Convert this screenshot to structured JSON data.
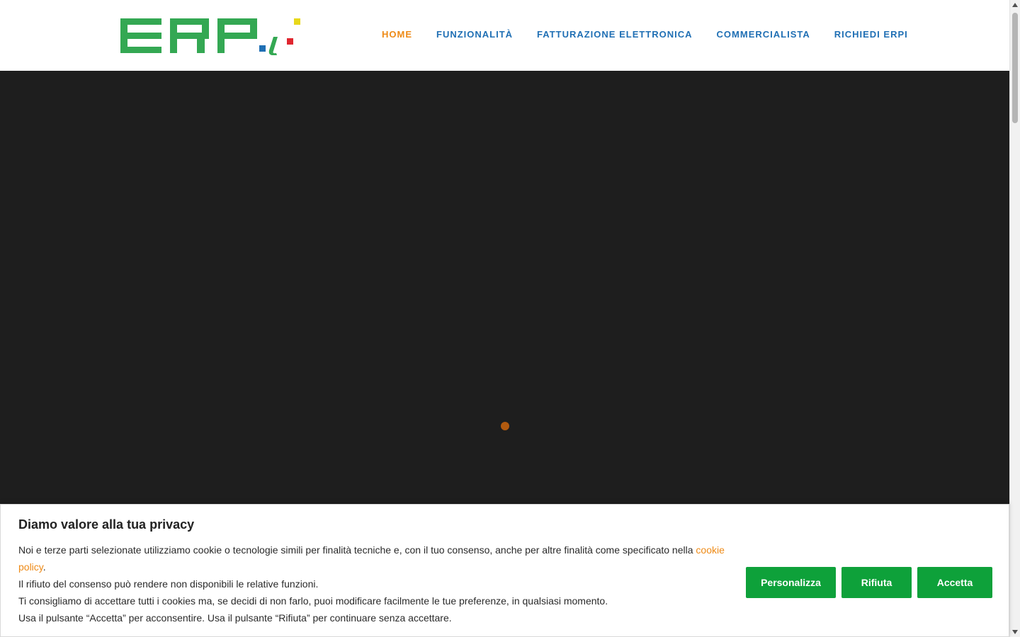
{
  "brand": {
    "logo_text": "ERPi",
    "colors": {
      "green": "#34a853",
      "blue": "#1f6fb4",
      "red": "#e0262f",
      "yellow": "#e8d81a"
    }
  },
  "nav": {
    "items": [
      {
        "label": "HOME",
        "active": true
      },
      {
        "label": "FUNZIONALITÀ",
        "active": false
      },
      {
        "label": "FATTURAZIONE ELETTRONICA",
        "active": false
      },
      {
        "label": "COMMERCIALISTA",
        "active": false
      },
      {
        "label": "RICHIEDI ERPI",
        "active": false
      }
    ],
    "colors": {
      "default": "#1f6fb4",
      "active": "#ee8a16"
    }
  },
  "hero": {
    "background": "#1e1e1e",
    "loading_indicator_color": "#b25a0f"
  },
  "cookie_banner": {
    "title": "Diamo valore alla tua privacy",
    "paragraph1_before_link": "Noi e terze parti selezionate utilizziamo cookie o tecnologie simili per finalità tecniche e, con il tuo consenso, anche per altre finalità come specificato nella ",
    "link_label": "cookie policy",
    "paragraph1_after_link": ".",
    "line2": "Il rifiuto del consenso può rendere non disponibili le relative funzioni.",
    "line3": "Ti consigliamo di accettare tutti i cookies ma, se decidi di non farlo, puoi modificare facilmente le tue preferenze, in qualsiasi momento.",
    "line4": "Usa il pulsante “Accetta” per acconsentire. Usa il pulsante “Rifiuta” per continuare senza accettare.",
    "buttons": {
      "customize": "Personalizza",
      "reject": "Rifiuta",
      "accept": "Accetta"
    },
    "button_color": "#0ea13a"
  }
}
